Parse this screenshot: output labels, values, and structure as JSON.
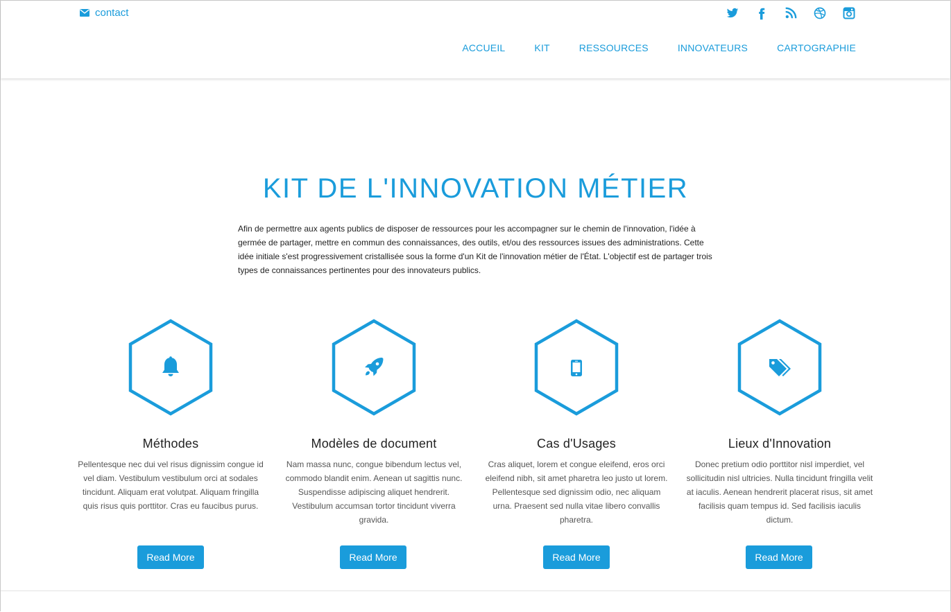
{
  "colors": {
    "accent": "#1a9cdb",
    "text": "#222222",
    "muted": "#555555",
    "button_text": "#ffffff"
  },
  "header": {
    "contact": {
      "icon": "envelope-icon",
      "label": "contact"
    },
    "social": [
      {
        "name": "twitter",
        "icon": "twitter-icon"
      },
      {
        "name": "facebook",
        "icon": "facebook-icon"
      },
      {
        "name": "rss",
        "icon": "rss-icon"
      },
      {
        "name": "dribbble",
        "icon": "dribbble-icon"
      },
      {
        "name": "instagram",
        "icon": "instagram-icon"
      }
    ],
    "nav": [
      {
        "label": "ACCUEIL"
      },
      {
        "label": "KIT"
      },
      {
        "label": "RESSOURCES"
      },
      {
        "label": "INNOVATEURS"
      },
      {
        "label": "CARTOGRAPHIE"
      }
    ]
  },
  "hero": {
    "title": "KIT DE L'INNOVATION MÉTIER",
    "intro": "Afin de permettre aux agents publics de disposer de ressources pour les accompagner sur le chemin de l'innovation, l'idée à germée de partager, mettre en commun des connaissances, des outils, et/ou des ressources issues des administrations. Cette idée initiale s'est progressivement cristallisée sous la forme d'un Kit de l'innovation métier de l'État. L'objectif est de partager trois types de connaissances pertinentes pour des innovateurs publics."
  },
  "features": [
    {
      "icon": "bell-icon",
      "title": "Méthodes",
      "text": "Pellentesque nec dui vel risus dignissim congue id vel diam. Vestibulum vestibulum orci at sodales tincidunt. Aliquam erat volutpat. Aliquam fringilla quis risus quis porttitor. Cras eu faucibus purus.",
      "button": "Read More"
    },
    {
      "icon": "rocket-icon",
      "title": "Modèles de document",
      "text": "Nam massa nunc, congue bibendum lectus vel, commodo blandit enim. Aenean ut sagittis nunc. Suspendisse adipiscing aliquet hendrerit. Vestibulum accumsan tortor tincidunt viverra gravida.",
      "button": "Read More"
    },
    {
      "icon": "mobile-phone-icon",
      "title": "Cas d'Usages",
      "text": "Cras aliquet, lorem et congue eleifend, eros orci eleifend nibh, sit amet pharetra leo justo ut lorem. Pellentesque sed dignissim odio, nec aliquam urna. Praesent sed nulla vitae libero convallis pharetra.",
      "button": "Read More"
    },
    {
      "icon": "tags-icon",
      "title": "Lieux d'Innovation",
      "text": "Donec pretium odio porttitor nisl imperdiet, vel sollicitudin nisl ultricies. Nulla tincidunt fringilla velit at iaculis. Aenean hendrerit placerat risus, sit amet facilisis quam tempus id. Sed facilisis iaculis dictum.",
      "button": "Read More"
    }
  ]
}
